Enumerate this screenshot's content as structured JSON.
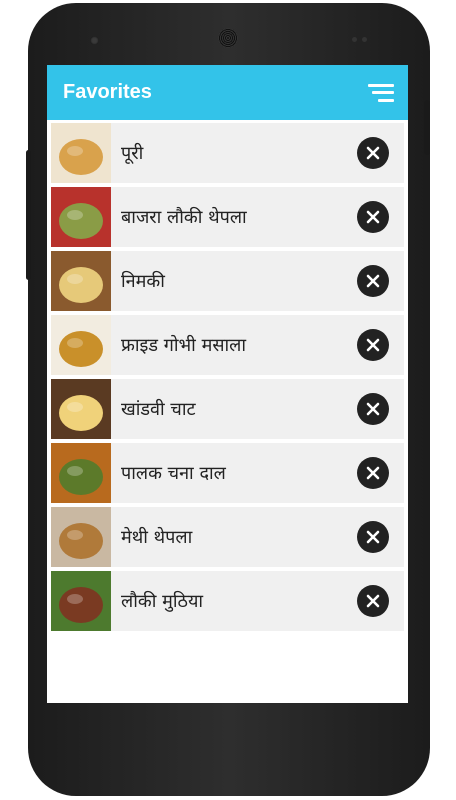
{
  "header": {
    "title": "Favorites",
    "menu_icon": "sort-icon"
  },
  "colors": {
    "appbar": "#33c3e9",
    "row_bg": "#f0f0f0",
    "remove_button": "#222222"
  },
  "favorites": [
    {
      "label": "पूरी",
      "thumb_colors": [
        "#efe4cf",
        "#d9a24c"
      ]
    },
    {
      "label": "बाजरा लौकी थेपला",
      "thumb_colors": [
        "#b8322c",
        "#8a9c46"
      ]
    },
    {
      "label": "निमकी",
      "thumb_colors": [
        "#8a5a2e",
        "#e6c979"
      ]
    },
    {
      "label": "फ्राइड गोभी मसाला",
      "thumb_colors": [
        "#f2ece0",
        "#c9902a"
      ]
    },
    {
      "label": "खांडवी चाट",
      "thumb_colors": [
        "#5a3a22",
        "#f0d27a"
      ]
    },
    {
      "label": "पालक चना दाल",
      "thumb_colors": [
        "#b86a1e",
        "#5c7a2a"
      ]
    },
    {
      "label": "मेथी थेपला",
      "thumb_colors": [
        "#c9b8a2",
        "#b07a3a"
      ]
    },
    {
      "label": "लौकी मुठिया",
      "thumb_colors": [
        "#4d7a2e",
        "#7a3a22"
      ]
    }
  ],
  "remove_icon": "close-icon"
}
